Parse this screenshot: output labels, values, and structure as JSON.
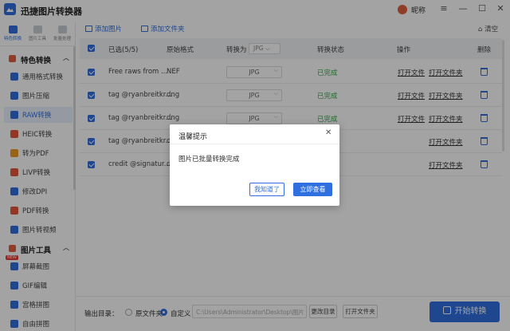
{
  "app": {
    "title": "迅捷图片转换器",
    "user_name": "昵称",
    "window_buttons": [
      "minimize-icon",
      "maximize-icon",
      "close-icon"
    ]
  },
  "rail_tabs": [
    {
      "label": "特色转换",
      "active": true
    },
    {
      "label": "图片工具",
      "active": false
    },
    {
      "label": "批量处理",
      "active": false
    }
  ],
  "sidebar": {
    "section1": "特色转换",
    "section2": "图片工具",
    "items1": [
      {
        "label": "通用格式转换",
        "color": "#2f6fe0"
      },
      {
        "label": "图片压缩",
        "color": "#2f6fe0"
      },
      {
        "label": "RAW转换",
        "color": "#2f6fe0",
        "active": true
      },
      {
        "label": "HEIC转换",
        "color": "#e05a3a"
      },
      {
        "label": "转为PDF",
        "color": "#f09a2b"
      },
      {
        "label": "LIVP转换",
        "color": "#e05a3a"
      },
      {
        "label": "修改DPI",
        "color": "#2f6fe0"
      },
      {
        "label": "PDF转换",
        "color": "#e05a3a"
      },
      {
        "label": "图片转视频",
        "color": "#2f6fe0"
      }
    ],
    "items2": [
      {
        "label": "屏幕截图",
        "color": "#2f6fe0",
        "badge": "NEW"
      },
      {
        "label": "GIF编辑",
        "color": "#2f6fe0"
      },
      {
        "label": "宫格拼图",
        "color": "#2f6fe0"
      },
      {
        "label": "自由拼图",
        "color": "#2f6fe0"
      }
    ]
  },
  "toolbar": {
    "add_image": "添加图片",
    "add_folder": "添加文件夹",
    "clear": "清空"
  },
  "table": {
    "headers": {
      "selected": "已选(5/5)",
      "original_format": "原始格式",
      "convert_to": "转换为",
      "convert_to_value": "JPG",
      "status": "转换状态",
      "actions": "操作",
      "delete": "删除"
    },
    "rows": [
      {
        "name": "Free raws from ...",
        "format": "NEF",
        "target": "JPG",
        "status": "已完成",
        "open_file": "打开文件",
        "open_folder": "打开文件夹"
      },
      {
        "name": "tag @ryanbreitkr...",
        "format": "dng",
        "target": "JPG",
        "status": "已完成",
        "open_file": "打开文件",
        "open_folder": "打开文件夹"
      },
      {
        "name": "tag @ryanbreitkr...",
        "format": "dng",
        "target": "JPG",
        "status": "已完成",
        "open_file": "打开文件",
        "open_folder": "打开文件夹"
      },
      {
        "name": "tag @ryanbreitkr...",
        "format": "d",
        "target": "",
        "status": "",
        "open_file": "",
        "open_folder": "打开文件夹"
      },
      {
        "name": "credit @signatur...",
        "format": "d",
        "target": "",
        "status": "",
        "open_file": "",
        "open_folder": "打开文件夹"
      }
    ]
  },
  "bottom": {
    "output_label": "输出目录：",
    "option_original": "原文件夹",
    "option_custom": "自定义",
    "path": "C:\\Users\\Administrator\\Desktop\\图片",
    "change_dir": "更改目录",
    "open_folder": "打开文件夹",
    "start": "开始转换"
  },
  "dialog": {
    "title": "温馨提示",
    "message": "图片已批量转换完成",
    "cancel": "我知道了",
    "confirm": "立即查看"
  }
}
